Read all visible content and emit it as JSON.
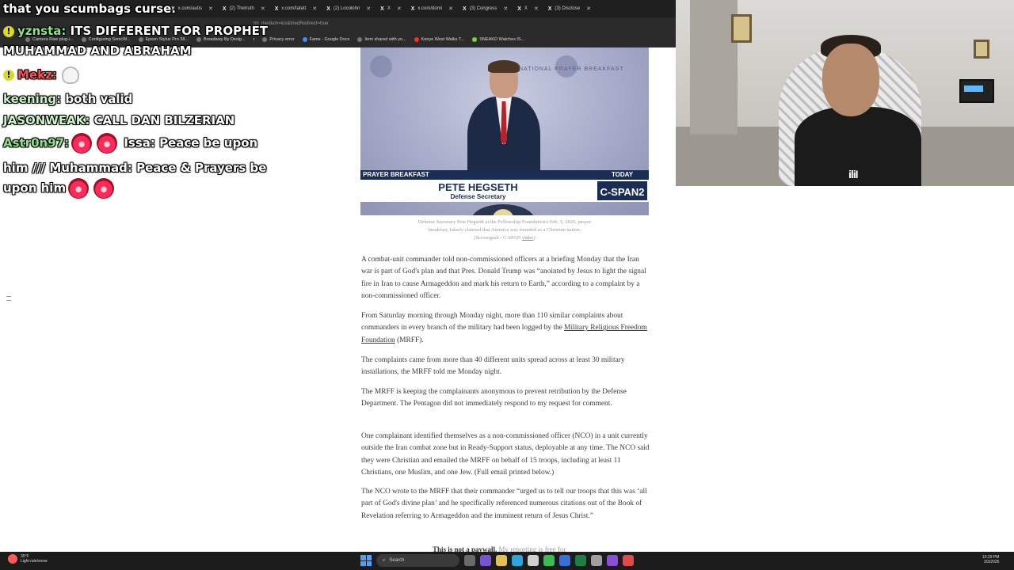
{
  "browser": {
    "tabs": [
      {
        "label": "x.com/autis"
      },
      {
        "label": "(2) Thetruth"
      },
      {
        "label": "x.com/tatett"
      },
      {
        "label": "(2) Locolohn"
      },
      {
        "label": "X"
      },
      {
        "label": "x.com/domi"
      },
      {
        "label": "(3) Congress"
      },
      {
        "label": "X"
      },
      {
        "label": "(3) Disclose"
      }
    ],
    "address_fragment": "tm_medium=ios&triedRedirect=true",
    "bookmarks": [
      "Camera Raw plug-i...",
      "Configuring SonicW...",
      "Epson Stylus Pro 38...",
      "Broadway By Desig...",
      "r",
      "Privacy error",
      "Fame - Google Docs",
      "Item shared with yo...",
      "Kanye West Walks T...",
      "SNEAKO Watches IS..."
    ]
  },
  "chat": {
    "lines": [
      {
        "text": "that you scumbags curse."
      },
      {
        "user": "yznsta:",
        "text": " ITS DIFFERENT FOR PROPHET"
      },
      {
        "text": "MUHAMMAD AND ABRAHAM"
      },
      {
        "user": "Mekz:",
        "text": ""
      },
      {
        "user": "keening:",
        "text": " both valid"
      },
      {
        "user": "JASONWEAK:",
        "text": " CALL DAN BILZERIAN"
      },
      {
        "user": "Astr0n97:",
        "text": " Issa: Peace be upon"
      },
      {
        "text": "him /// Muhammad: Peace & Prayers be"
      },
      {
        "text": "upon him"
      }
    ]
  },
  "article": {
    "image": {
      "label_left": "PRAYER BREAKFAST",
      "label_right": "TODAY",
      "name": "PETE HEGSETH",
      "title": "Defense Secretary",
      "network": "C-SPAN2",
      "background_text": "NATIONAL PRAYER BREAKFAST"
    },
    "caption_line1": "Defense Secretary Pete Hegseth at the Fellowship Foundation's Feb. 5, 2026, prayer",
    "caption_line2": "breakfast, falsely claimed that America was founded as a Christian nation.",
    "caption_line3": "(Screengrab / C-SPAN ",
    "caption_link": "video",
    "caption_end": ")",
    "p1": "A combat-unit commander told non-commissioned officers at a briefing Monday that the Iran war is part of God's plan and that Pres. Donald Trump was “anointed by Jesus to light the signal fire in Iran to cause Armageddon and mark his return to Earth,” according to a complaint by a non-commissioned officer.",
    "p2_before": "From Saturday morning through Monday night, more than 110 similar complaints about commanders in every branch of the military had been logged by the ",
    "p2_link": "Military Religious Freedom Foundation",
    "p2_after": " (MRFF).",
    "p3": "The complaints came from more than 40 different units spread across at least 30 military installations, the MRFF told me Monday night.",
    "p4": "The MRFF is keeping the complainants anonymous to prevent retribution by the Defense Department. The Pentagon did not immediately respond to my request for comment.",
    "p5": "One complainant identified themselves as a non-commissioned officer (NCO) in a unit currently outside the Iran combat zone but in Ready-Support status, deployable at any time. The NCO said they were Christian and emailed the MRFF on behalf of 15 troops, including at least 11 Christians, one Muslim, and one Jew. (Full email printed below.)",
    "p6": "The NCO wrote to the MRFF that their commander “urged us to tell our troops that this was ‘all part of God's divine plan’ and he specifically referenced numerous citations out of the Book of Revelation referring to Armageddon and the imminent return of Jesus Christ.”",
    "paywall_bold": "This is not a paywall.",
    "paywall_rest": " My reporting is free for"
  },
  "taskbar": {
    "temperature": "35°F",
    "weather": "Light rain/snow",
    "search_placeholder": "Search",
    "time": "10:29 PM",
    "date": "3/3/2026"
  }
}
